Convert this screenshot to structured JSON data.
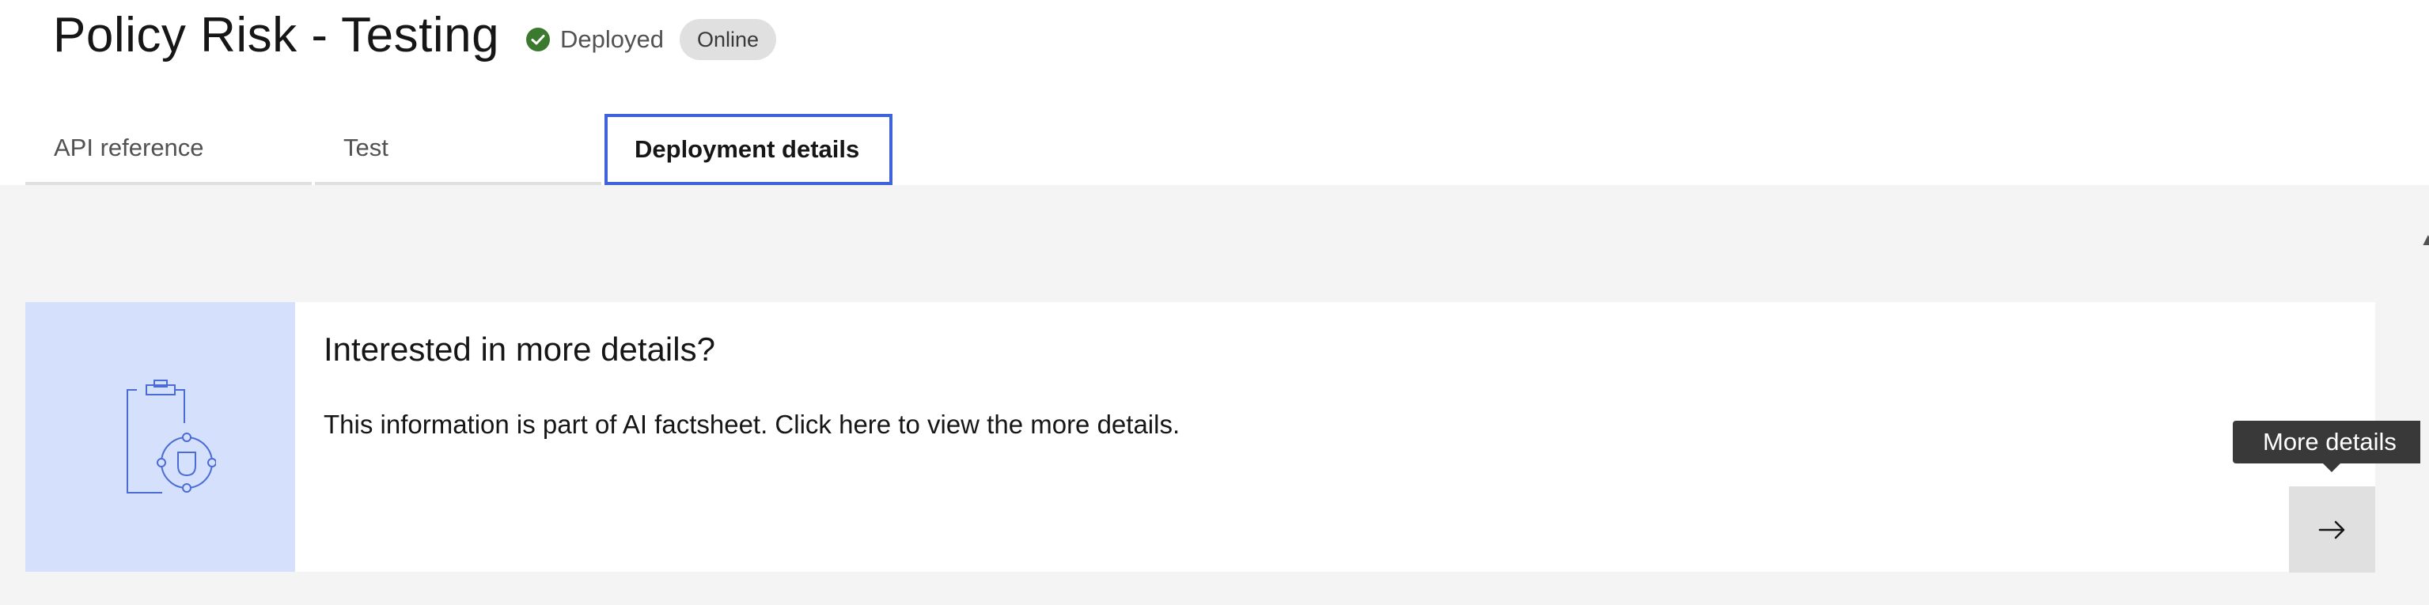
{
  "header": {
    "title": "Policy Risk - Testing",
    "status": {
      "icon": "checkmark-filled-icon",
      "label": "Deployed",
      "color": "#24a148"
    },
    "tag": "Online"
  },
  "tabs": [
    {
      "label": "API reference",
      "active": false
    },
    {
      "label": "Test",
      "active": false
    },
    {
      "label": "Deployment details",
      "active": true
    }
  ],
  "card": {
    "illustration_icon": "clipboard-shield-icon",
    "title": "Interested in more details?",
    "description": "This information is part of AI factsheet. Click here to view the more details.",
    "tooltip": "More details",
    "action_icon": "arrow-right-icon"
  },
  "colors": {
    "accent": "#3e63dd",
    "illustration_bg": "#d5e0fd",
    "content_bg": "#f4f4f4",
    "tooltip_bg": "#393939",
    "status_success": "#24a148"
  }
}
